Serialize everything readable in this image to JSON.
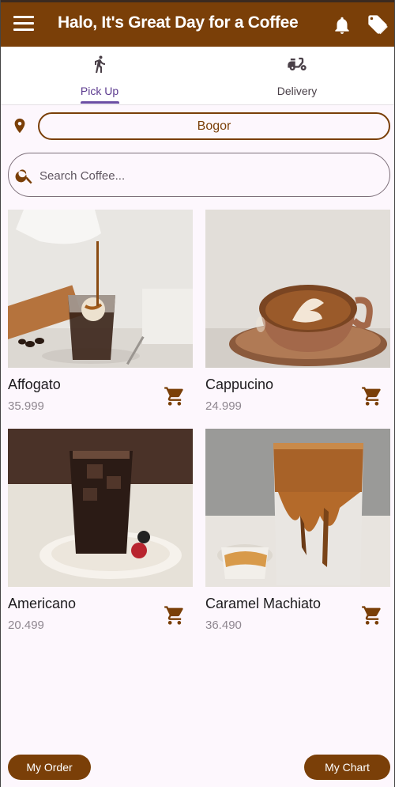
{
  "appbar": {
    "title": "Halo, It's Great Day for a Coffee",
    "menu_icon": "menu-icon",
    "actions": [
      "bell-icon",
      "tag-icon"
    ],
    "color": "#7a3f08"
  },
  "tabs": [
    {
      "label": "Pick Up",
      "icon": "walking-icon",
      "active": true
    },
    {
      "label": "Delivery",
      "icon": "scooter-icon",
      "active": false
    }
  ],
  "location": {
    "value": "Bogor",
    "icon": "location-pin-icon"
  },
  "search": {
    "placeholder": "Search Coffee...",
    "value": ""
  },
  "products": [
    {
      "name": "Affogato",
      "price": "35.999"
    },
    {
      "name": "Cappucino",
      "price": "24.999"
    },
    {
      "name": "Americano",
      "price": "20.499"
    },
    {
      "name": "Caramel Machiato",
      "price": "36.490"
    }
  ],
  "bottom": {
    "my_order": "My Order",
    "my_chart": "My Chart"
  }
}
